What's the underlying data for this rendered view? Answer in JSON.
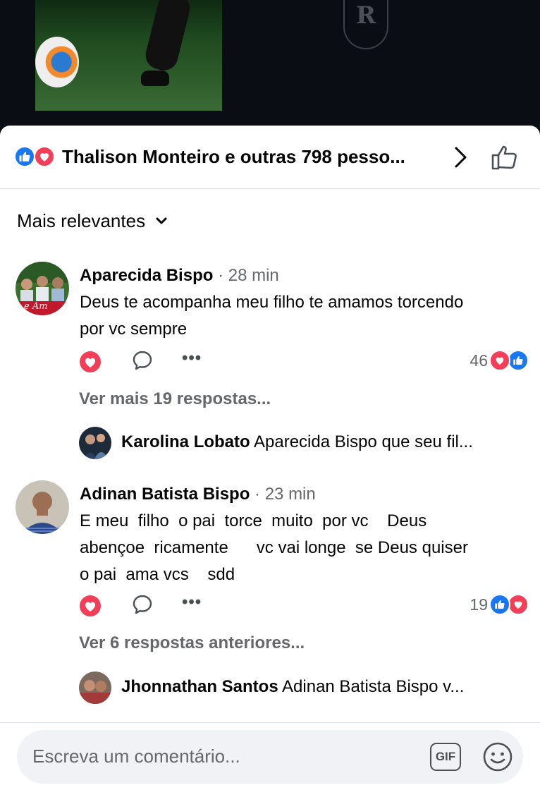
{
  "background": {
    "crest_text": "R"
  },
  "reactions": {
    "icons": [
      "like-icon",
      "love-icon"
    ],
    "summary": "Thalison Monteiro e outras 798 pesso..."
  },
  "sort": {
    "label": "Mais relevantes"
  },
  "comments": [
    {
      "author": "Aparecida Bispo",
      "separator": "·",
      "time": "28 min",
      "text": "Deus te acompanha meu filho te amamos torcendo\npor vc sempre",
      "avatar_caption": "e Am",
      "reaction_count": "46",
      "reaction_icons": [
        "love-icon",
        "like-icon"
      ],
      "more_replies": "Ver mais 19 respostas...",
      "reply": {
        "author": "Karolina Lobato",
        "text": "Aparecida Bispo que seu fil..."
      }
    },
    {
      "author": "Adinan Batista Bispo",
      "separator": "·",
      "time": "23 min",
      "text": "E meu  filho  o pai  torce  muito  por vc    Deus\nabençoe  ricamente      vc vai longe  se Deus quiser\no pai  ama vcs    sdd",
      "reaction_count": "19",
      "reaction_icons": [
        "like-icon",
        "love-icon"
      ],
      "more_replies": "Ver 6 respostas anteriores...",
      "reply": {
        "author": "Jhonnathan Santos",
        "text": "Adinan Batista Bispo  v..."
      }
    }
  ],
  "composer": {
    "placeholder": "Escreva um comentário...",
    "gif_label": "GIF"
  },
  "colors": {
    "like_blue": "#1877f2",
    "love_red": "#f33e58",
    "secondary_text": "#65676b",
    "composer_bg": "#f0f2f5"
  }
}
